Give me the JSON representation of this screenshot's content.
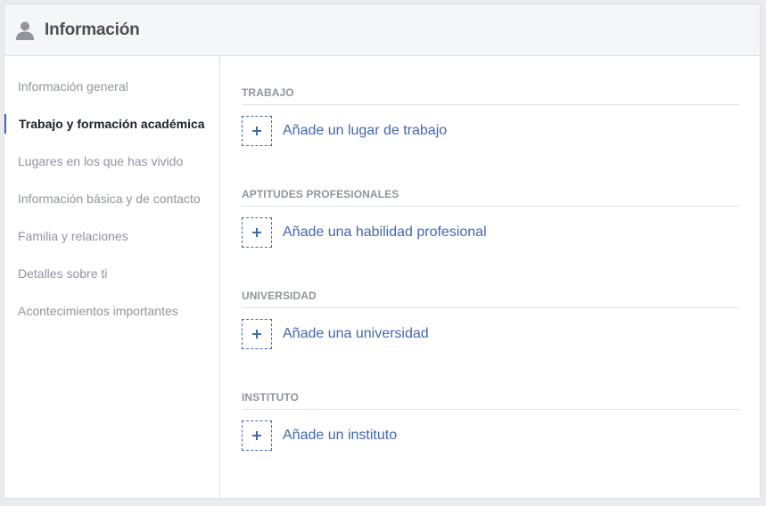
{
  "header": {
    "title": "Información",
    "icon": "user-silhouette-icon"
  },
  "sidebar": {
    "items": [
      {
        "label": "Información general",
        "active": false
      },
      {
        "label": "Trabajo y formación académica",
        "active": true
      },
      {
        "label": "Lugares en los que has vivido",
        "active": false
      },
      {
        "label": "Información básica y de contacto",
        "active": false
      },
      {
        "label": "Familia y relaciones",
        "active": false
      },
      {
        "label": "Detalles sobre ti",
        "active": false
      },
      {
        "label": "Acontecimientos importantes",
        "active": false
      }
    ]
  },
  "sections": [
    {
      "title": "TRABAJO",
      "add_label": "Añade un lugar de trabajo"
    },
    {
      "title": "APTITUDES PROFESIONALES",
      "add_label": "Añade una habilidad profesional"
    },
    {
      "title": "UNIVERSIDAD",
      "add_label": "Añade una universidad"
    },
    {
      "title": "INSTITUTO",
      "add_label": "Añade un instituto"
    }
  ],
  "colors": {
    "accent": "#4267b2",
    "muted_text": "#90949c",
    "header_bg": "#f5f6f7",
    "border": "#dddfe2"
  }
}
